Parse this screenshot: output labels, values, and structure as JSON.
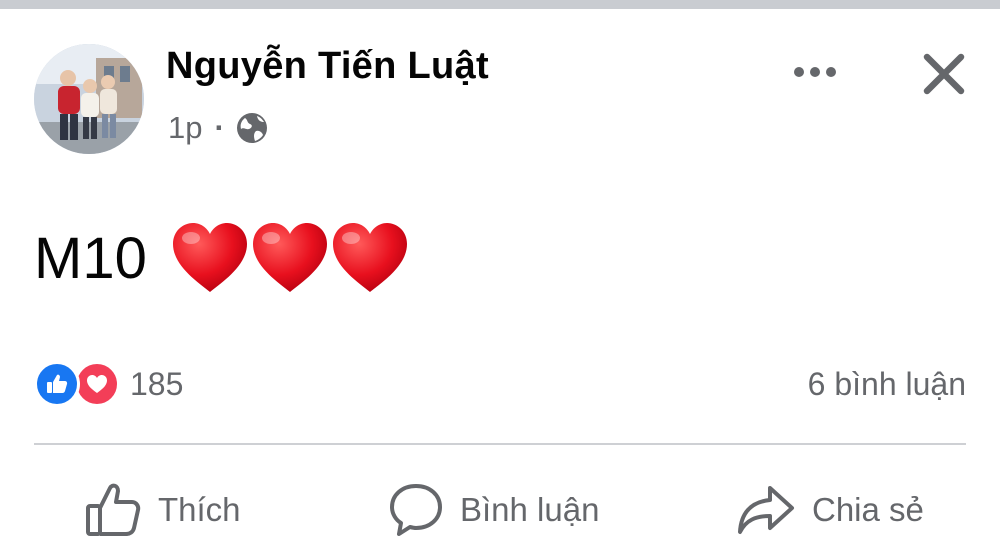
{
  "post": {
    "author": "Nguyễn Tiến Luật",
    "time": "1p",
    "separator": "·",
    "privacy_icon": "globe-icon",
    "content_text": "M10",
    "content_emoji": [
      "heart-emoji",
      "heart-emoji",
      "heart-emoji"
    ],
    "reactions": {
      "types": [
        "like",
        "love"
      ],
      "count": "185"
    },
    "comments_count": "6 bình luận",
    "actions": {
      "like_label": "Thích",
      "comment_label": "Bình luận",
      "share_label": "Chia sẻ"
    }
  },
  "colors": {
    "like_blue": "#1877f2",
    "love_red": "#f33e58",
    "secondary_text": "#65676b",
    "primary_text": "#050505"
  }
}
